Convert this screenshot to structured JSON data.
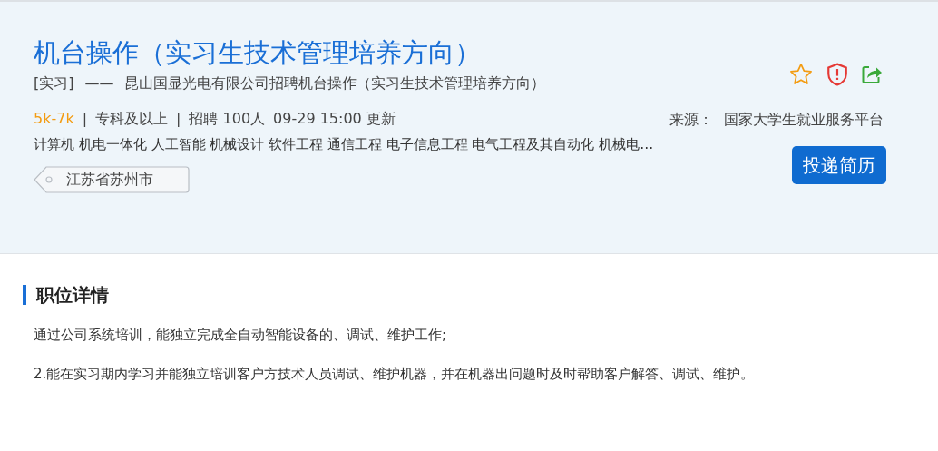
{
  "job": {
    "title": "机台操作（实习生技术管理培养方向）",
    "type": "[实习]",
    "dash": "——",
    "subtitle": "昆山国显光电有限公司招聘机台操作（实习生技术管理培养方向）",
    "meta": [
      {
        "kind": "salary",
        "text": "5k-7k"
      },
      {
        "kind": "sep",
        "text": "|"
      },
      {
        "kind": "plain",
        "text": "专科及以上"
      },
      {
        "kind": "sep",
        "text": "|"
      },
      {
        "kind": "plain",
        "text": "招聘 100人"
      },
      {
        "kind": "plain",
        "text": "09-29 15:00 更新"
      }
    ],
    "majors": "计算机 机电一体化 人工智能 机械设计 软件工程 通信工程 电子信息工程 电气工程及其自动化 机械电…",
    "location": "江苏省苏州市",
    "source_label": "来源：",
    "source": "国家大学生就业服务平台",
    "apply_button": "投递简历"
  },
  "details": {
    "heading": "职位详情",
    "paragraphs": [
      "通过公司系统培训，能独立完成全自动智能设备的、调试、维护工作;",
      "2.能在实习期内学习并能独立培训客户方技术人员调试、维护机器，并在机器出问题时及时帮助客户解答、调试、维护。"
    ]
  }
}
